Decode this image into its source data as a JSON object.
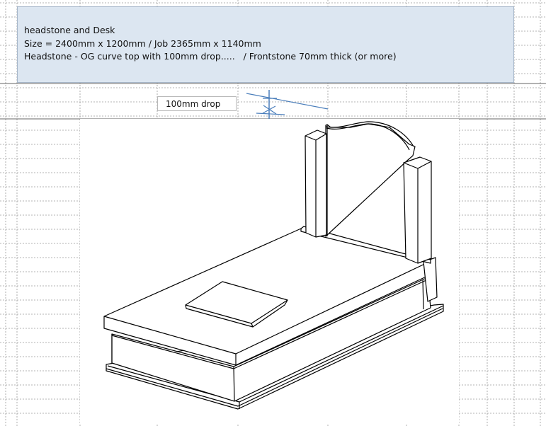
{
  "note": {
    "line1": "headstone and Desk",
    "line2": "Size = 2400mm x 1200mm / Job 2365mm x 1140mm",
    "line3": "Headstone - OG curve top with 100mm drop.....   / Frontstone 70mm thick (or more)"
  },
  "drop_label": "100mm drop",
  "colors": {
    "note_background": "#dce6f1",
    "marker_blue": "#4a7ebb",
    "grid_line": "#9a9a9a",
    "drawing_line": "#000000"
  }
}
